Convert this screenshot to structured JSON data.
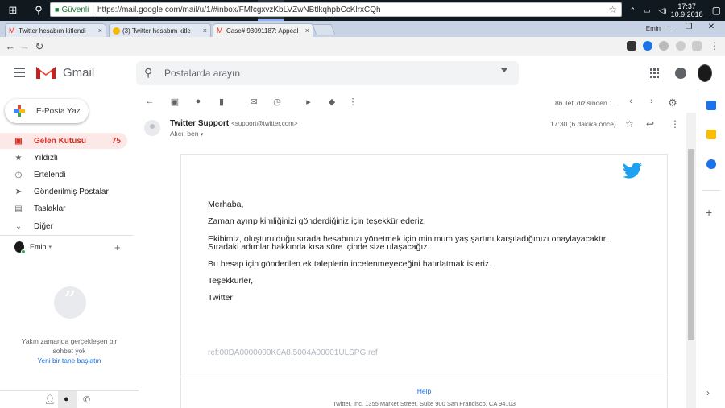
{
  "taskbar": {
    "apps": [
      {
        "name": "windows-start-icon",
        "glyph": "⊞",
        "color": "#ffffff"
      },
      {
        "name": "search-icon",
        "glyph": "○",
        "color": "#ffffff"
      },
      {
        "name": "task-view-icon",
        "glyph": "▭",
        "color": "#ffffff"
      },
      {
        "name": "store-icon",
        "glyph": "",
        "color": "#3b9be8"
      },
      {
        "name": "edge-icon",
        "glyph": "e",
        "color": "#1e90ff"
      },
      {
        "name": "file-explorer-icon",
        "glyph": "",
        "color": "#f0c24b"
      },
      {
        "name": "mail-icon",
        "glyph": "",
        "color": "#ffffff"
      },
      {
        "name": "discord-icon",
        "glyph": "",
        "color": "#7289da"
      },
      {
        "name": "yandex-icon",
        "glyph": "Y",
        "color": "#ff0000"
      },
      {
        "name": "photoshop-icon",
        "glyph": "Ps",
        "color": "#1a2a4a"
      },
      {
        "name": "chrome-icon",
        "glyph": "",
        "color": "#4caf50"
      },
      {
        "name": "app-icon",
        "glyph": "",
        "color": "#3b7dd8"
      },
      {
        "name": "opera-icon",
        "glyph": "O",
        "color": "#ff1b2d"
      }
    ],
    "time": "17:37",
    "date": "10.9.2018"
  },
  "browser": {
    "tabs": [
      {
        "title": "Twitter hesabım kitlendi",
        "active": false
      },
      {
        "title": "(3) Twitter hesabım kitle",
        "active": false
      },
      {
        "title": "Case# 93091187: Appeal",
        "active": true
      }
    ],
    "user_label": "Emin",
    "secure_label": "Güvenli",
    "url": "https://mail.google.com/mail/u/1/#inbox/FMfcgxvzKbLVZwNBtlkqhpbCcKlrxCQh"
  },
  "gmail": {
    "logo_text": "Gmail",
    "search_placeholder": "Postalarda arayın",
    "compose_label": "E-Posta Yaz",
    "nav": [
      {
        "label": "Gelen Kutusu",
        "icon": "▣",
        "count": "75",
        "active": true
      },
      {
        "label": "Yıldızlı",
        "icon": "★",
        "count": "",
        "active": false
      },
      {
        "label": "Ertelendi",
        "icon": "◷",
        "count": "",
        "active": false
      },
      {
        "label": "Gönderilmiş Postalar",
        "icon": "➤",
        "count": "",
        "active": false
      },
      {
        "label": "Taslaklar",
        "icon": "▤",
        "count": "",
        "active": false
      },
      {
        "label": "Diğer",
        "icon": "⌄",
        "count": "",
        "active": false
      }
    ],
    "hangouts_user": "Emin",
    "no_chat_text_1": "Yakın zamanda gerçekleşen bir",
    "no_chat_text_2": "sohbet yok",
    "new_chat_link": "Yeni bir tane başlatın",
    "page_info": "86 ileti dizisinden 1."
  },
  "message": {
    "sender_name": "Twitter Support",
    "sender_email": "<support@twitter.com>",
    "recipient": "Alıcı: ben",
    "time": "17:30 (6 dakika önce)",
    "greeting": "Merhaba,",
    "para1": "Zaman ayırıp kimliğinizi gönderdiğiniz için teşekkür ederiz.",
    "para2_line1": "Ekibimiz, oluşturulduğu sırada hesabınızı yönetmek için minimum yaş şartını karşıladığınızı onaylayacaktır.",
    "para2_line2": "Sıradaki adımlar hakkında kısa süre içinde size ulaşacağız.",
    "para3": "Bu hesap için gönderilen ek taleplerin incelenmeyeceğini hatırlatmak isteriz.",
    "thanks": "Teşekkürler,",
    "signature": "Twitter",
    "ref": "ref:00DA0000000K0A8.5004A00001ULSPG:ref",
    "help_link": "Help",
    "footer_address": "Twitter, Inc. 1355 Market Street, Suite 900 San Francisco, CA 94103"
  },
  "colors": {
    "accent_red": "#d93025",
    "link_blue": "#1a73e8",
    "twitter_blue": "#1da1f2"
  }
}
